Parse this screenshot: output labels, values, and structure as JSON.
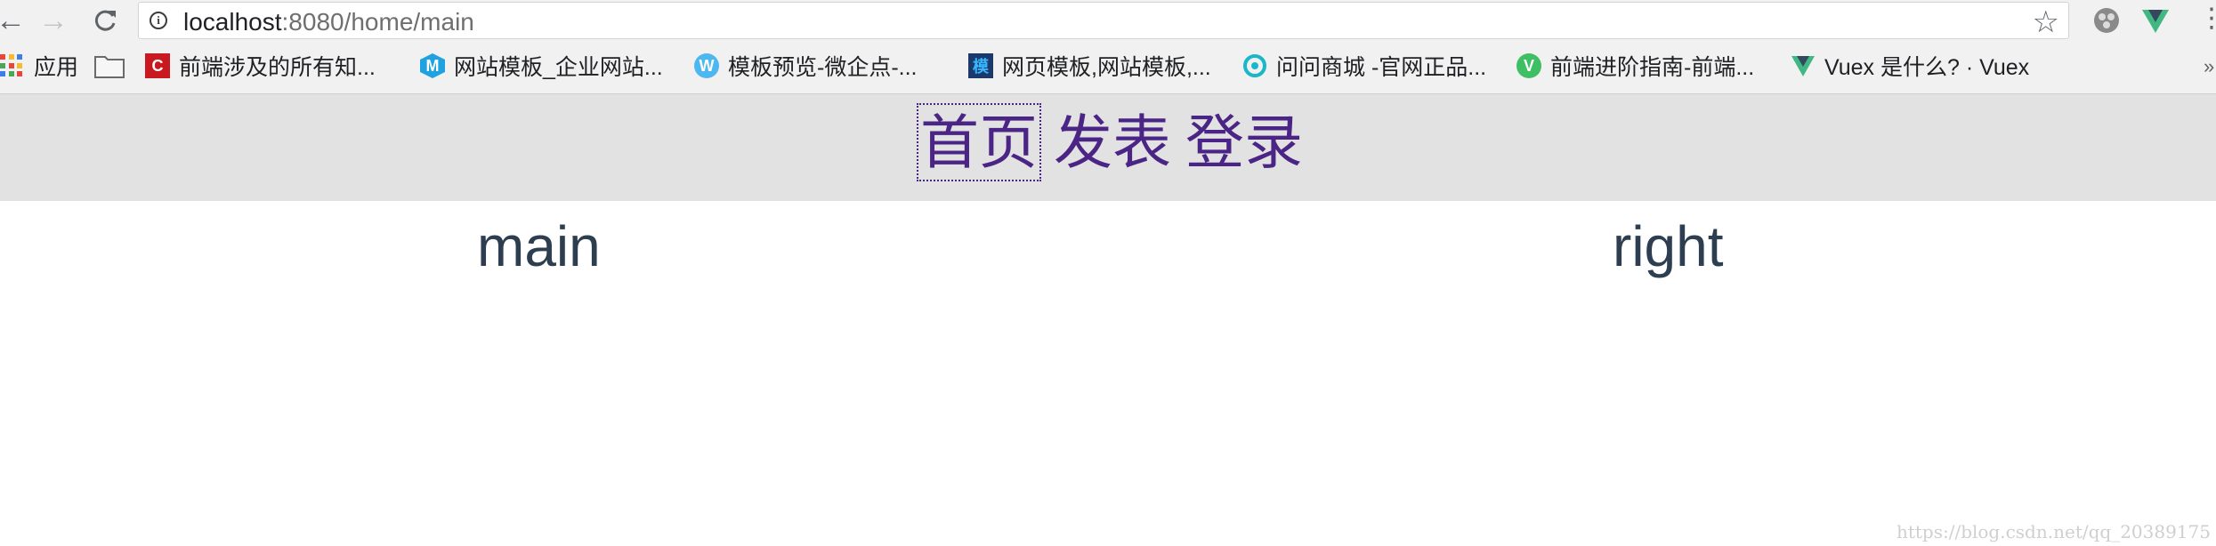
{
  "browser": {
    "url_host": "localhost",
    "url_rest": ":8080/home/main",
    "icons": [
      "back-arrow-icon",
      "forward-arrow-icon",
      "reload-icon",
      "info-icon",
      "star-icon",
      "extension-icon",
      "vue-devtools-icon",
      "menu-icon"
    ]
  },
  "bookmarks": [
    {
      "label": "应用",
      "icon": "apps-icon"
    },
    {
      "label": "",
      "icon": "folder-icon"
    },
    {
      "label": "前端涉及的所有知...",
      "icon": "c-icon",
      "color": "#c9181e"
    },
    {
      "label": "网站模板_企业网站...",
      "icon": "m-icon",
      "color": "#1fa3e0"
    },
    {
      "label": "模板预览-微企点-...",
      "icon": "w-icon",
      "color": "#4db8f0"
    },
    {
      "label": "网页模板,网站模板,...",
      "icon": "mo-icon",
      "color": "#1b3a6b"
    },
    {
      "label": "问问商城 -官网正品...",
      "icon": "swirl-icon",
      "color": "#19b7c7"
    },
    {
      "label": "前端进阶指南-前端...",
      "icon": "v-icon",
      "color": "#3fbf63"
    },
    {
      "label": "Vuex 是什么? · Vuex",
      "icon": "vue-icon",
      "color": "#41b883"
    }
  ],
  "more_bookmarks": "»",
  "page": {
    "nav": [
      "首页",
      "发表",
      "登录"
    ],
    "main_label": "main",
    "right_label": "right"
  },
  "watermark": "https://blog.csdn.net/qq_20389175"
}
